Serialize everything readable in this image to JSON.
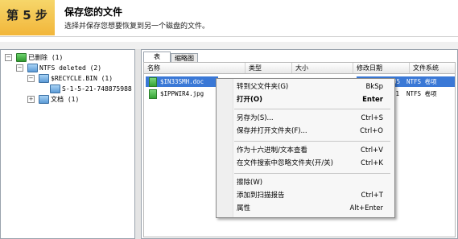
{
  "header": {
    "step": "第 5 步",
    "title": "保存您的文件",
    "subtitle": "选择并保存您想要恢复到另一个磁盘的文件。"
  },
  "tree": {
    "items": [
      {
        "label": "已删除 (1)",
        "expander": "−"
      },
      {
        "label": "NTFS deleted (2)",
        "expander": "−"
      },
      {
        "label": "$RECYCLE.BIN (1)",
        "expander": "−"
      },
      {
        "label": "S-1-5-21-748875988-1",
        "expander": ""
      },
      {
        "label": "文档 (1)",
        "expander": "+"
      }
    ]
  },
  "tabs": {
    "table": "表",
    "thumbnails": "缩略图"
  },
  "columns": {
    "name": "名称",
    "type": "类型",
    "size": "大小",
    "modified": "修改日期",
    "filesystem": "文件系统"
  },
  "rows": [
    {
      "name": "$IN33SMH.doc",
      "modified_tail": "4:05",
      "filesystem": "NTFS 卷项"
    },
    {
      "name": "$IPPWIR4.jpg",
      "modified_tail": "31",
      "filesystem": "NTFS 卷项"
    }
  ],
  "context_menu": {
    "items": [
      {
        "label": "转到父文件夹(G)",
        "shortcut": "BkSp",
        "bold": false
      },
      {
        "label": "打开(O)",
        "shortcut": "Enter",
        "bold": true
      },
      {
        "label": "另存为(S)...",
        "shortcut": "Ctrl+S",
        "bold": false
      },
      {
        "label": "保存并打开文件夹(F)...",
        "shortcut": "Ctrl+O",
        "bold": false
      },
      {
        "label": "作为十六进制/文本查看",
        "shortcut": "Ctrl+V",
        "bold": false
      },
      {
        "label": "在文件搜索中忽略文件夹(开/关)",
        "shortcut": "Ctrl+K",
        "bold": false
      },
      {
        "label": "擦除(W)",
        "shortcut": "",
        "bold": false
      },
      {
        "label": "添加到扫描报告",
        "shortcut": "Ctrl+T",
        "bold": false
      },
      {
        "label": "属性",
        "shortcut": "Alt+Enter",
        "bold": false
      }
    ]
  },
  "colors": {
    "step_accent": "#f2b63a",
    "selection": "#3a78d6",
    "folder_green": "#2f9a2f",
    "folder_blue": "#5c9bd6"
  }
}
